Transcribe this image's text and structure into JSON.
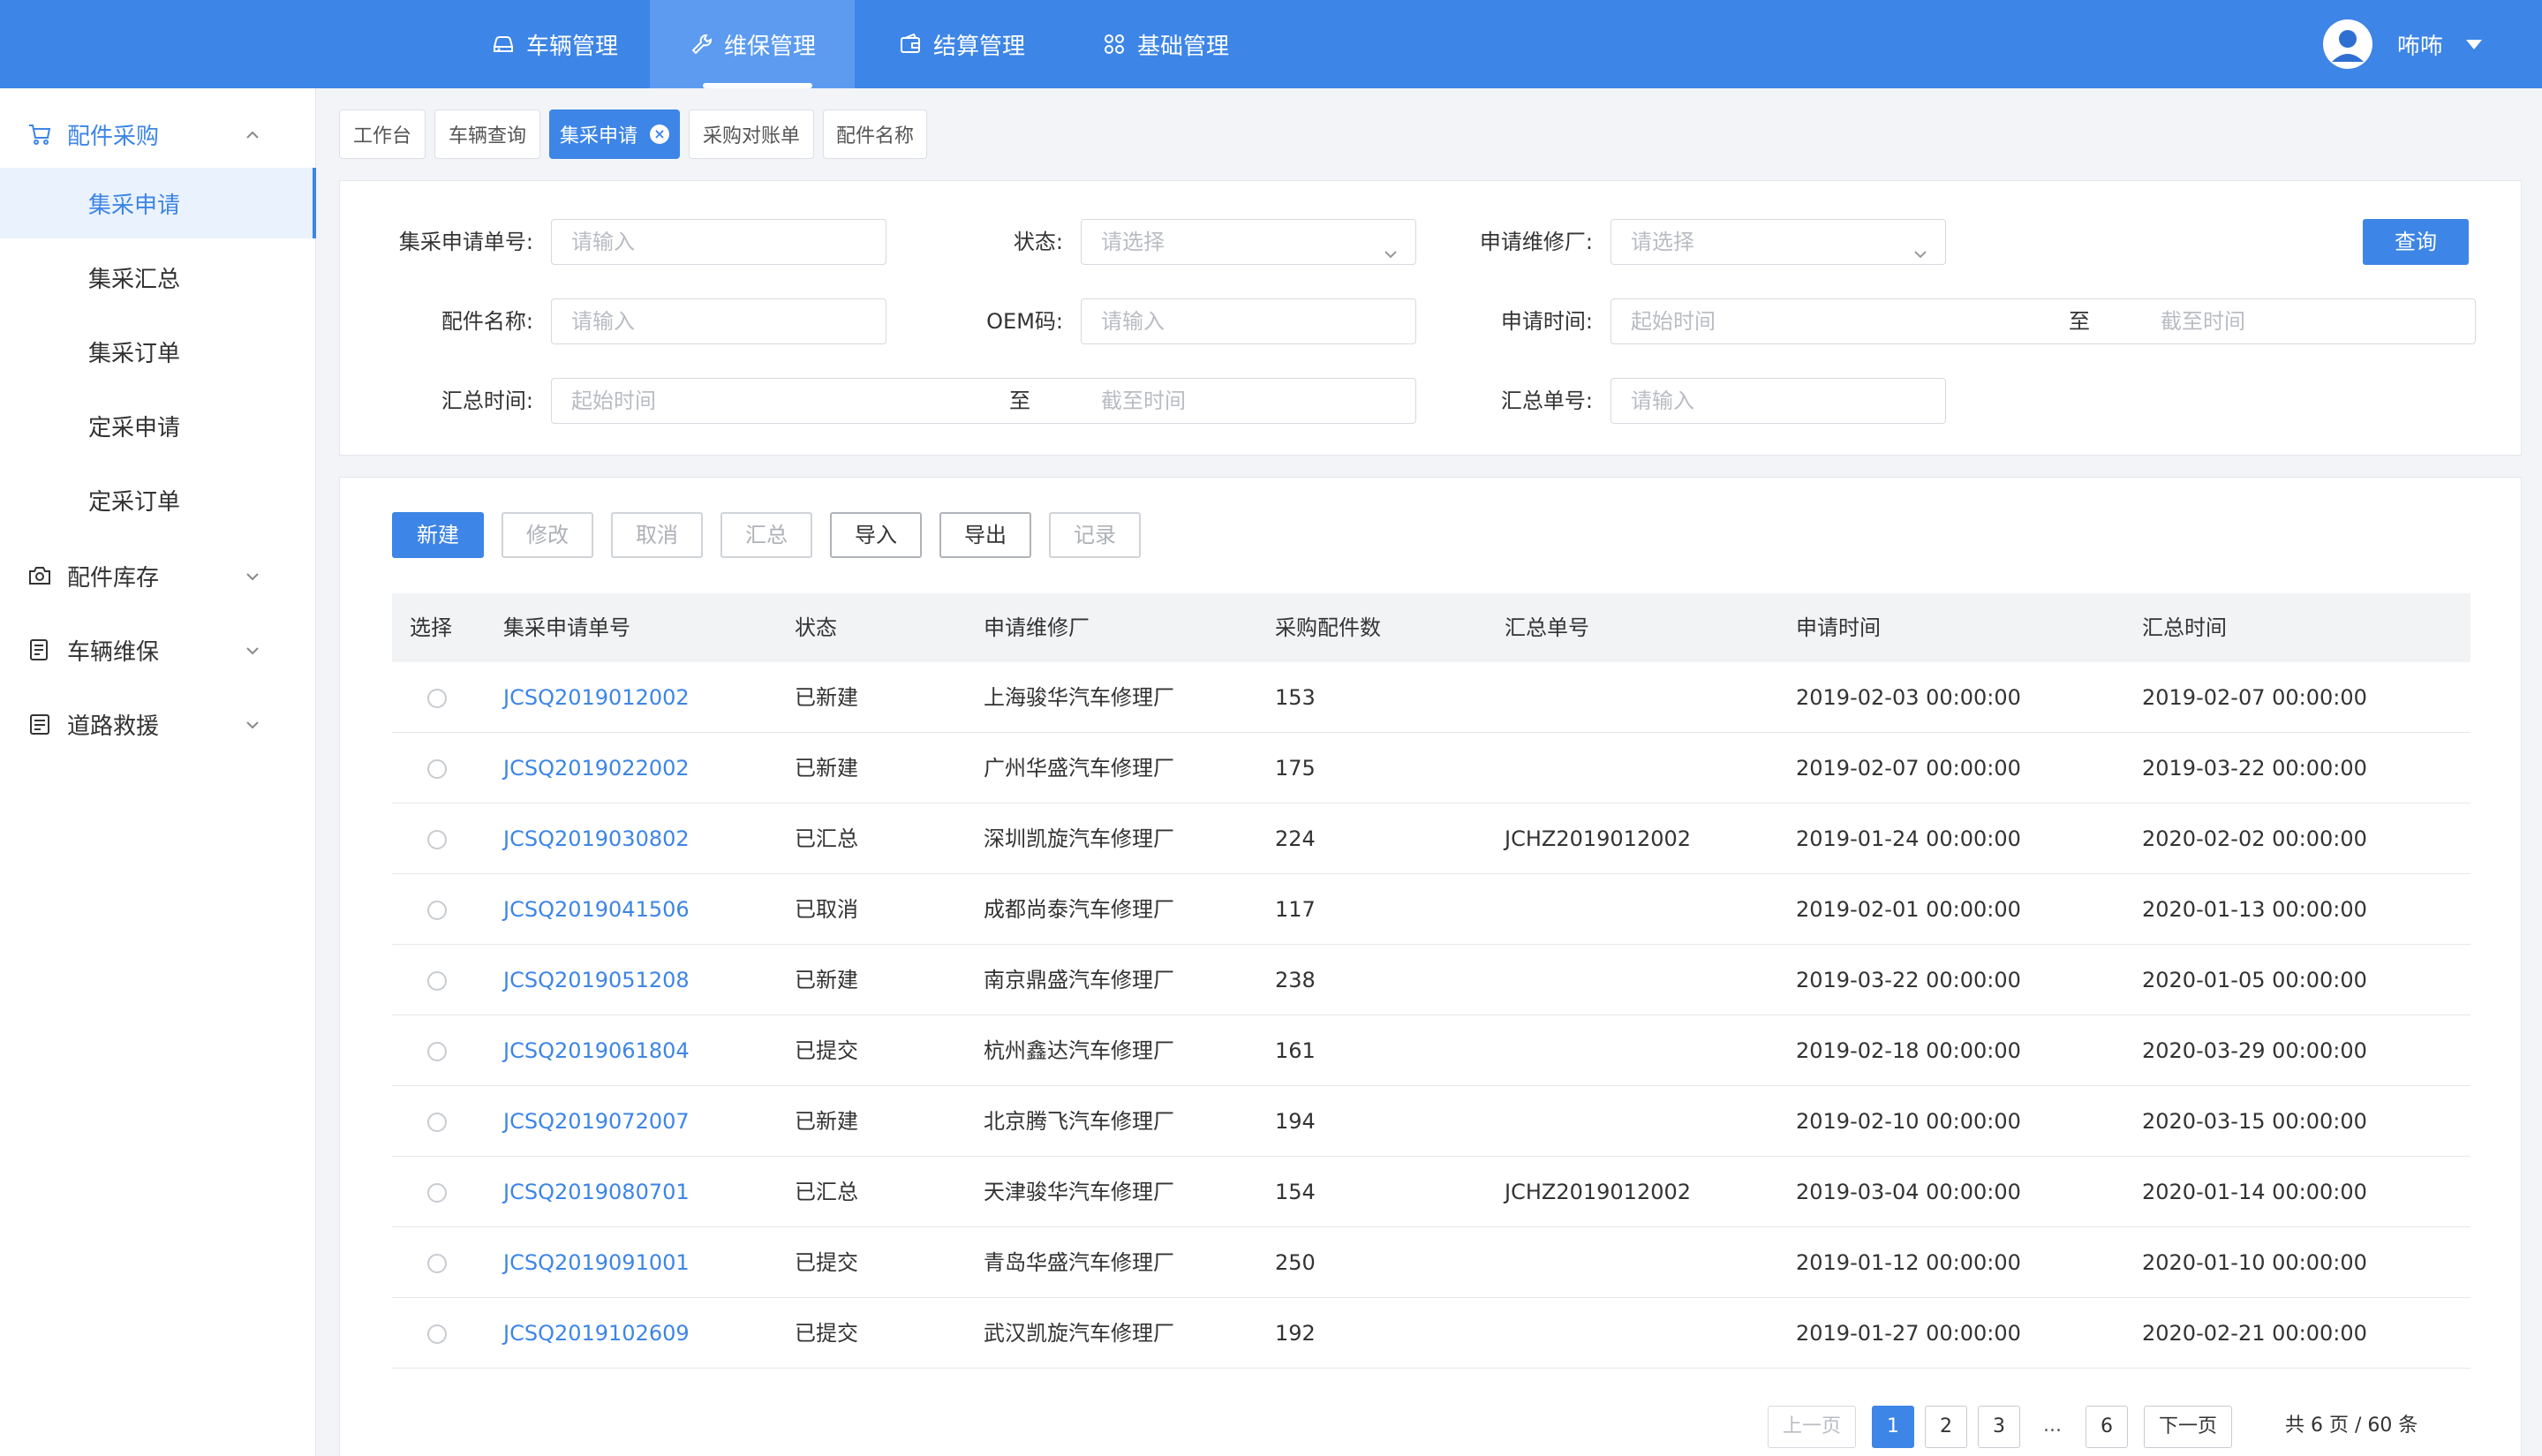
{
  "colors": {
    "primary": "#3d85e6",
    "link": "#3d85e6",
    "nav_active": "#5c9bef"
  },
  "nav": {
    "items": [
      {
        "label": "车辆管理",
        "icon": "car-icon"
      },
      {
        "label": "维保管理",
        "icon": "wrench-icon",
        "active": true
      },
      {
        "label": "结算管理",
        "icon": "wallet-icon"
      },
      {
        "label": "基础管理",
        "icon": "grid-icon"
      }
    ],
    "user": {
      "name": "咘咘"
    }
  },
  "sidebar": {
    "groups": [
      {
        "label": "配件采购",
        "icon": "cart-icon",
        "open": true,
        "items": [
          "集采申请",
          "集采汇总",
          "集采订单",
          "定采申请",
          "定采订单"
        ],
        "active_item": "集采申请"
      },
      {
        "label": "配件库存",
        "icon": "camera-icon"
      },
      {
        "label": "车辆维保",
        "icon": "file-icon"
      },
      {
        "label": "道路救援",
        "icon": "clipboard-icon"
      }
    ]
  },
  "tabs": [
    "工作台",
    "车辆查询",
    "集采申请",
    "采购对账单",
    "配件名称"
  ],
  "filters": {
    "apply_no": {
      "label": "集采申请单号:",
      "placeholder": "请输入"
    },
    "status": {
      "label": "状态:",
      "placeholder": "请选择"
    },
    "factory": {
      "label": "申请维修厂:",
      "placeholder": "请选择"
    },
    "part_name": {
      "label": "配件名称:",
      "placeholder": "请输入"
    },
    "oem": {
      "label": "OEM码:",
      "placeholder": "请输入"
    },
    "apply_time": {
      "label": "申请时间:",
      "start": "起始时间",
      "sep": "至",
      "end": "截至时间"
    },
    "summary_time": {
      "label": "汇总时间:",
      "start": "起始时间",
      "sep": "至",
      "end": "截至时间"
    },
    "summary_no": {
      "label": "汇总单号:",
      "placeholder": "请输入"
    },
    "query_label": "查询"
  },
  "actions": {
    "new": "新建",
    "edit": "修改",
    "cancel": "取消",
    "summary": "汇总",
    "import": "导入",
    "export": "导出",
    "record": "记录"
  },
  "table": {
    "headers": [
      "选择",
      "集采申请单号",
      "状态",
      "申请维修厂",
      "采购配件数",
      "汇总单号",
      "申请时间",
      "汇总时间"
    ],
    "rows": [
      {
        "no": "JCSQ2019012002",
        "status": "已新建",
        "factory": "上海骏华汽车修理厂",
        "count": "153",
        "summary_no": "",
        "apply_time": "2019-02-03 00:00:00",
        "summary_time": "2019-02-07 00:00:00"
      },
      {
        "no": "JCSQ2019022002",
        "status": "已新建",
        "factory": "广州华盛汽车修理厂",
        "count": "175",
        "summary_no": "",
        "apply_time": "2019-02-07 00:00:00",
        "summary_time": "2019-03-22 00:00:00"
      },
      {
        "no": "JCSQ2019030802",
        "status": "已汇总",
        "factory": "深圳凯旋汽车修理厂",
        "count": "224",
        "summary_no": "JCHZ2019012002",
        "apply_time": "2019-01-24 00:00:00",
        "summary_time": "2020-02-02 00:00:00"
      },
      {
        "no": "JCSQ2019041506",
        "status": "已取消",
        "factory": "成都尚泰汽车修理厂",
        "count": "117",
        "summary_no": "",
        "apply_time": "2019-02-01 00:00:00",
        "summary_time": "2020-01-13 00:00:00"
      },
      {
        "no": "JCSQ2019051208",
        "status": "已新建",
        "factory": "南京鼎盛汽车修理厂",
        "count": "238",
        "summary_no": "",
        "apply_time": "2019-03-22 00:00:00",
        "summary_time": "2020-01-05 00:00:00"
      },
      {
        "no": "JCSQ2019061804",
        "status": "已提交",
        "factory": "杭州鑫达汽车修理厂",
        "count": "161",
        "summary_no": "",
        "apply_time": "2019-02-18 00:00:00",
        "summary_time": "2020-03-29 00:00:00"
      },
      {
        "no": "JCSQ2019072007",
        "status": "已新建",
        "factory": "北京腾飞汽车修理厂",
        "count": "194",
        "summary_no": "",
        "apply_time": "2019-02-10 00:00:00",
        "summary_time": "2020-03-15 00:00:00"
      },
      {
        "no": "JCSQ2019080701",
        "status": "已汇总",
        "factory": "天津骏华汽车修理厂",
        "count": "154",
        "summary_no": "JCHZ2019012002",
        "apply_time": "2019-03-04 00:00:00",
        "summary_time": "2020-01-14 00:00:00"
      },
      {
        "no": "JCSQ2019091001",
        "status": "已提交",
        "factory": "青岛华盛汽车修理厂",
        "count": "250",
        "summary_no": "",
        "apply_time": "2019-01-12 00:00:00",
        "summary_time": "2020-01-10 00:00:00"
      },
      {
        "no": "JCSQ2019102609",
        "status": "已提交",
        "factory": "武汉凯旋汽车修理厂",
        "count": "192",
        "summary_no": "",
        "apply_time": "2019-01-27 00:00:00",
        "summary_time": "2020-02-21 00:00:00"
      }
    ]
  },
  "pagination": {
    "prev": "上一页",
    "next": "下一页",
    "pages": [
      "1",
      "2",
      "3"
    ],
    "ellipsis": "...",
    "last": "6",
    "info": "共 6 页 / 60 条"
  }
}
